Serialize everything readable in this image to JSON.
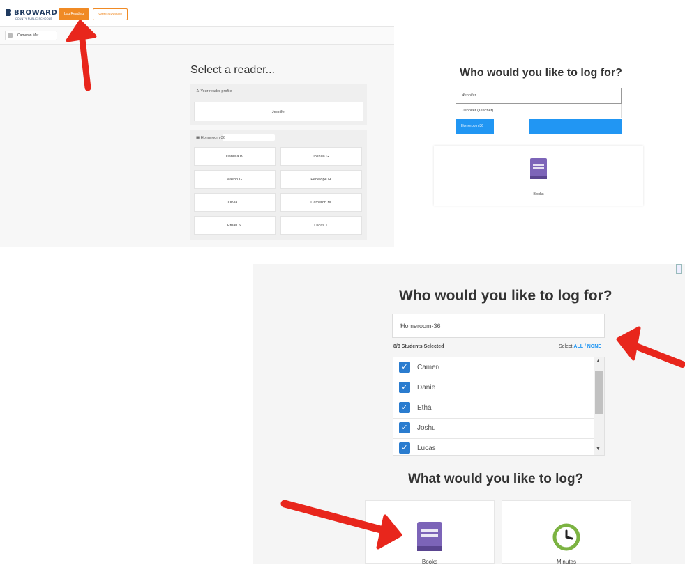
{
  "panel1": {
    "logo": "BROWARD",
    "logo_sub": "COUNTY PUBLIC SCHOOLS",
    "log_reading_button": "Log Reading",
    "write_review_button": "Write a Review",
    "user_chip": "Cameron Met...",
    "title": "Select a reader...",
    "reader_profile_header": "Your reader profile",
    "reader_profile_name": "Jennifer",
    "homeroom_header": "Homeroom-36",
    "students": [
      "Daniela B.",
      "Joshua G.",
      "Mason G.",
      "Penelope H.",
      "Olivia L.",
      "Cameron M.",
      "Ethan S.",
      "Lucas T."
    ]
  },
  "panel2": {
    "title": "Who would you like to log for?",
    "select_value": "Jennifer",
    "option1": "Jennifer (Teacher)",
    "option2": "Homeroom-36",
    "card_label": "Books"
  },
  "panel3": {
    "title": "Who would you like to log for?",
    "select_value": "Homeroom-36",
    "selected_count": "8/8 Students Selected",
    "select_prefix": "Select ",
    "select_all": "ALL",
    "select_sep": " / ",
    "select_none": "NONE",
    "students": [
      "Camero",
      "Danie",
      "Etha",
      "Joshu",
      "Lucas"
    ],
    "title2": "What would you like to log?",
    "cards": [
      "Books",
      "Minutes"
    ]
  },
  "colors": {
    "orange": "#f08a24",
    "blue": "#2196f3",
    "checkbox": "#2a7ccf",
    "arrow": "#e8261c",
    "book": "#7c64b8"
  },
  "icons": [
    "book-icon",
    "clock-icon",
    "check-icon",
    "caret-down-icon",
    "arrow-annotation"
  ]
}
